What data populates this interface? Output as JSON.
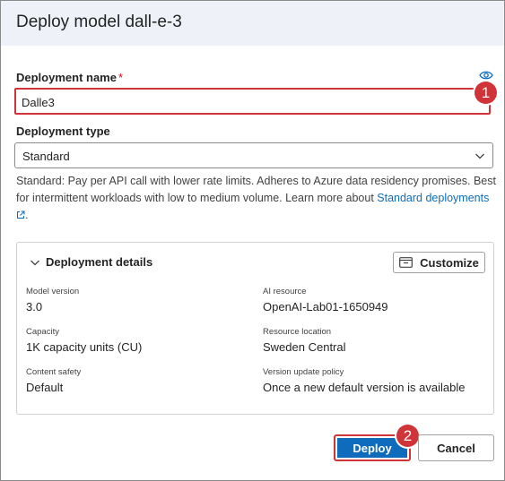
{
  "dialog": {
    "title": "Deploy model dall-e-3"
  },
  "deployment_name": {
    "label": "Deployment name",
    "required_marker": "*",
    "value": "Dalle3"
  },
  "deployment_type": {
    "label": "Deployment type",
    "selected": "Standard",
    "description": "Standard: Pay per API call with lower rate limits. Adheres to Azure data residency promises. Best for intermittent workloads with low to medium volume. Learn more about ",
    "link_text": "Standard deployments"
  },
  "details": {
    "title": "Deployment details",
    "customize_label": "Customize",
    "fields": {
      "model_version": {
        "label": "Model version",
        "value": "3.0"
      },
      "ai_resource": {
        "label": "AI resource",
        "value": "OpenAI-Lab01-1650949"
      },
      "capacity": {
        "label": "Capacity",
        "value": "1K capacity units (CU)"
      },
      "resource_location": {
        "label": "Resource location",
        "value": "Sweden Central"
      },
      "content_safety": {
        "label": "Content safety",
        "value": "Default"
      },
      "version_update_policy": {
        "label": "Version update policy",
        "value": "Once a new default version is available"
      }
    }
  },
  "footer": {
    "deploy_label": "Deploy",
    "cancel_label": "Cancel"
  },
  "callouts": {
    "first": "1",
    "second": "2"
  },
  "colors": {
    "accent": "#0f6cbd",
    "highlight": "#d13438",
    "header_bg": "#eef2f8"
  },
  "icons": [
    "eye-icon",
    "chevron-down-icon",
    "external-link-icon",
    "customize-icon"
  ]
}
